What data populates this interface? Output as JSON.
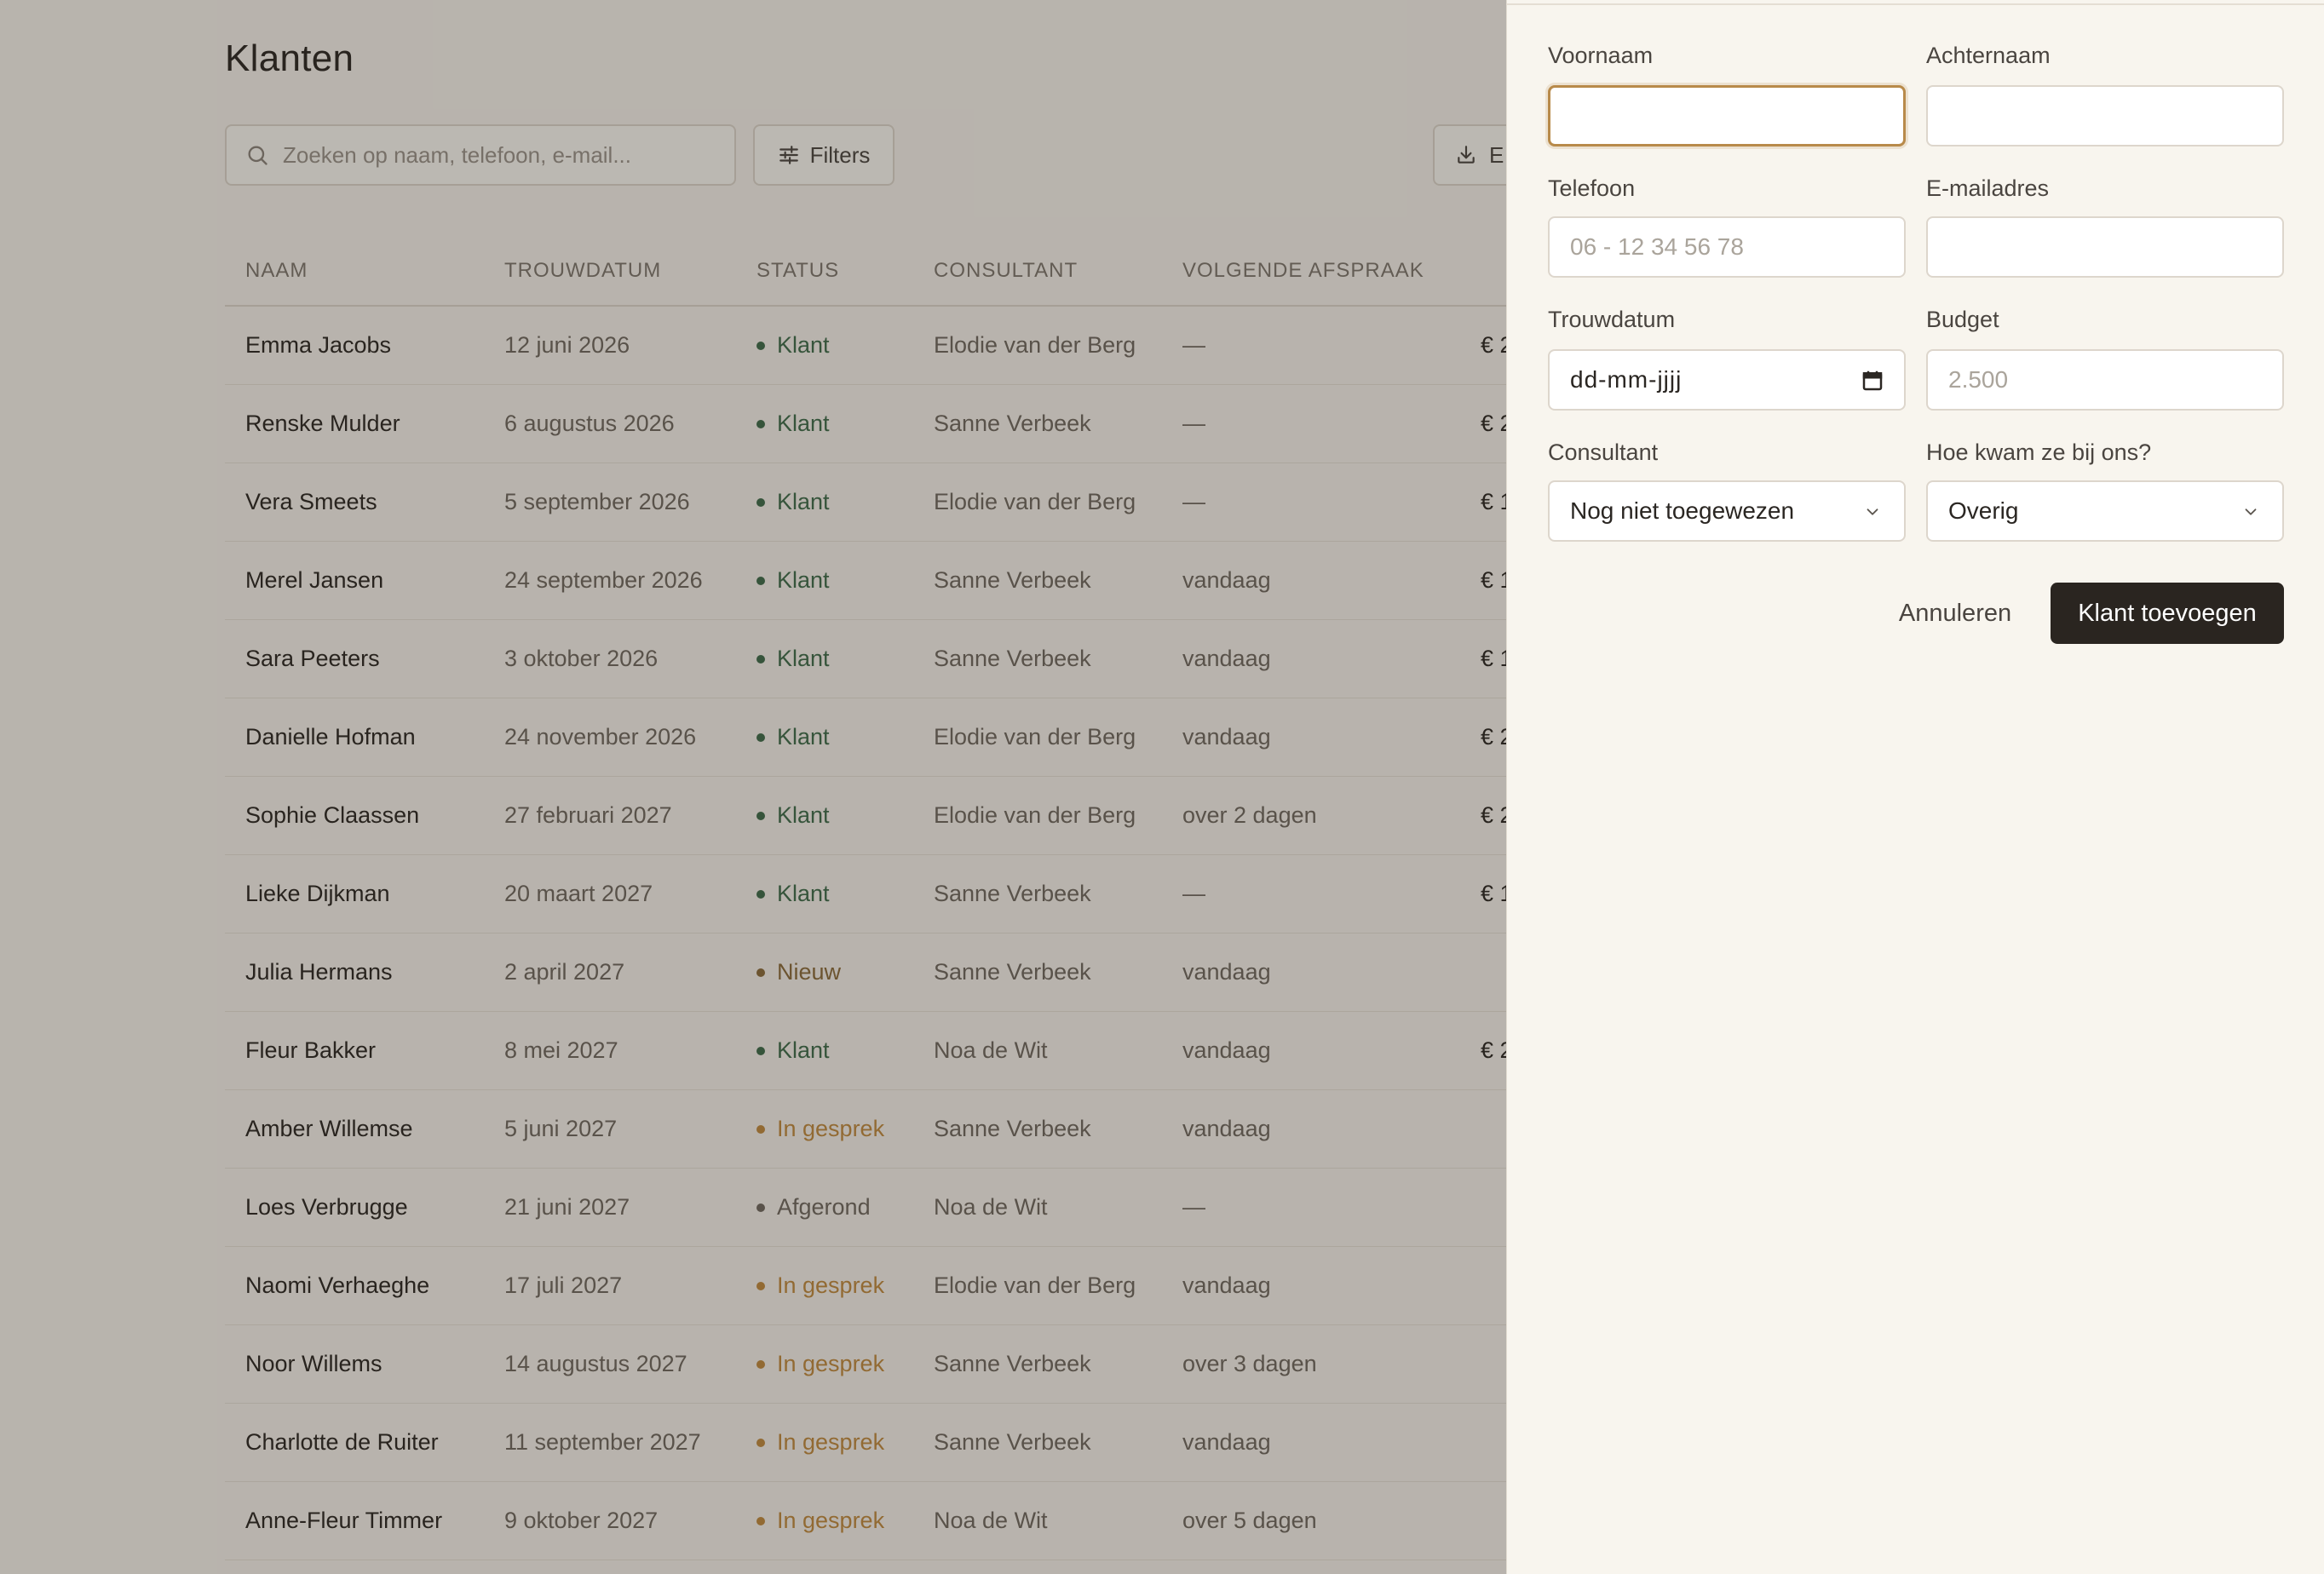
{
  "page": {
    "title": "Klanten",
    "search_placeholder": "Zoeken op naam, telefoon, e-mail...",
    "filters_label": "Filters",
    "export_label": "E"
  },
  "table": {
    "headers": [
      "NAAM",
      "TROUWDATUM",
      "STATUS",
      "CONSULTANT",
      "VOLGENDE AFSPRAAK"
    ],
    "rows": [
      {
        "name": "Emma Jacobs",
        "date": "12 juni 2026",
        "status": "Klant",
        "consultant": "Elodie van der Berg",
        "appointment": "—",
        "amount": "€ 2"
      },
      {
        "name": "Renske Mulder",
        "date": "6 augustus 2026",
        "status": "Klant",
        "consultant": "Sanne Verbeek",
        "appointment": "—",
        "amount": "€ 2"
      },
      {
        "name": "Vera Smeets",
        "date": "5 september 2026",
        "status": "Klant",
        "consultant": "Elodie van der Berg",
        "appointment": "—",
        "amount": "€ 1"
      },
      {
        "name": "Merel Jansen",
        "date": "24 september 2026",
        "status": "Klant",
        "consultant": "Sanne Verbeek",
        "appointment": "vandaag",
        "amount": "€ 1"
      },
      {
        "name": "Sara Peeters",
        "date": "3 oktober 2026",
        "status": "Klant",
        "consultant": "Sanne Verbeek",
        "appointment": "vandaag",
        "amount": "€ 1"
      },
      {
        "name": "Danielle Hofman",
        "date": "24 november 2026",
        "status": "Klant",
        "consultant": "Elodie van der Berg",
        "appointment": "vandaag",
        "amount": "€ 2"
      },
      {
        "name": "Sophie Claassen",
        "date": "27 februari 2027",
        "status": "Klant",
        "consultant": "Elodie van der Berg",
        "appointment": "over 2 dagen",
        "amount": "€ 2"
      },
      {
        "name": "Lieke Dijkman",
        "date": "20 maart 2027",
        "status": "Klant",
        "consultant": "Sanne Verbeek",
        "appointment": "—",
        "amount": "€ 1"
      },
      {
        "name": "Julia Hermans",
        "date": "2 april 2027",
        "status": "Nieuw",
        "consultant": "Sanne Verbeek",
        "appointment": "vandaag",
        "amount": ""
      },
      {
        "name": "Fleur Bakker",
        "date": "8 mei 2027",
        "status": "Klant",
        "consultant": "Noa de Wit",
        "appointment": "vandaag",
        "amount": "€ 2"
      },
      {
        "name": "Amber Willemse",
        "date": "5 juni 2027",
        "status": "In gesprek",
        "consultant": "Sanne Verbeek",
        "appointment": "vandaag",
        "amount": ""
      },
      {
        "name": "Loes Verbrugge",
        "date": "21 juni 2027",
        "status": "Afgerond",
        "consultant": "Noa de Wit",
        "appointment": "—",
        "amount": ""
      },
      {
        "name": "Naomi Verhaeghe",
        "date": "17 juli 2027",
        "status": "In gesprek",
        "consultant": "Elodie van der Berg",
        "appointment": "vandaag",
        "amount": ""
      },
      {
        "name": "Noor Willems",
        "date": "14 augustus 2027",
        "status": "In gesprek",
        "consultant": "Sanne Verbeek",
        "appointment": "over 3 dagen",
        "amount": ""
      },
      {
        "name": "Charlotte de Ruiter",
        "date": "11 september 2027",
        "status": "In gesprek",
        "consultant": "Sanne Verbeek",
        "appointment": "vandaag",
        "amount": ""
      },
      {
        "name": "Anne-Fleur Timmer",
        "date": "9 oktober 2027",
        "status": "In gesprek",
        "consultant": "Noa de Wit",
        "appointment": "over 5 dagen",
        "amount": ""
      }
    ]
  },
  "status_colors": {
    "Klant": "#3d6b4a",
    "Nieuw": "#8a6a3a",
    "In gesprek": "#c08a3e",
    "Afgerond": "#6f685f"
  },
  "form": {
    "first_name_label": "Voornaam",
    "first_name_value": "",
    "last_name_label": "Achternaam",
    "last_name_value": "",
    "phone_label": "Telefoon",
    "phone_placeholder": "06 - 12 34 56 78",
    "email_label": "E-mailadres",
    "email_value": "",
    "wedding_date_label": "Trouwdatum",
    "wedding_date_placeholder": "dd-mm-jjjj",
    "budget_label": "Budget",
    "budget_placeholder": "2.500",
    "consultant_label": "Consultant",
    "consultant_value": "Nog niet toegewezen",
    "source_label": "Hoe kwam ze bij ons?",
    "source_value": "Overig",
    "cancel_label": "Annuleren",
    "submit_label": "Klant toevoegen"
  },
  "icons": {
    "search": "search-icon",
    "filters": "sliders-icon",
    "export": "download-icon",
    "calendar": "calendar-icon",
    "chevron": "chevron-down-icon"
  },
  "colors": {
    "accent": "#b88a4a",
    "primary_button": "#2a2520",
    "panel_bg": "#f8f5ee"
  }
}
